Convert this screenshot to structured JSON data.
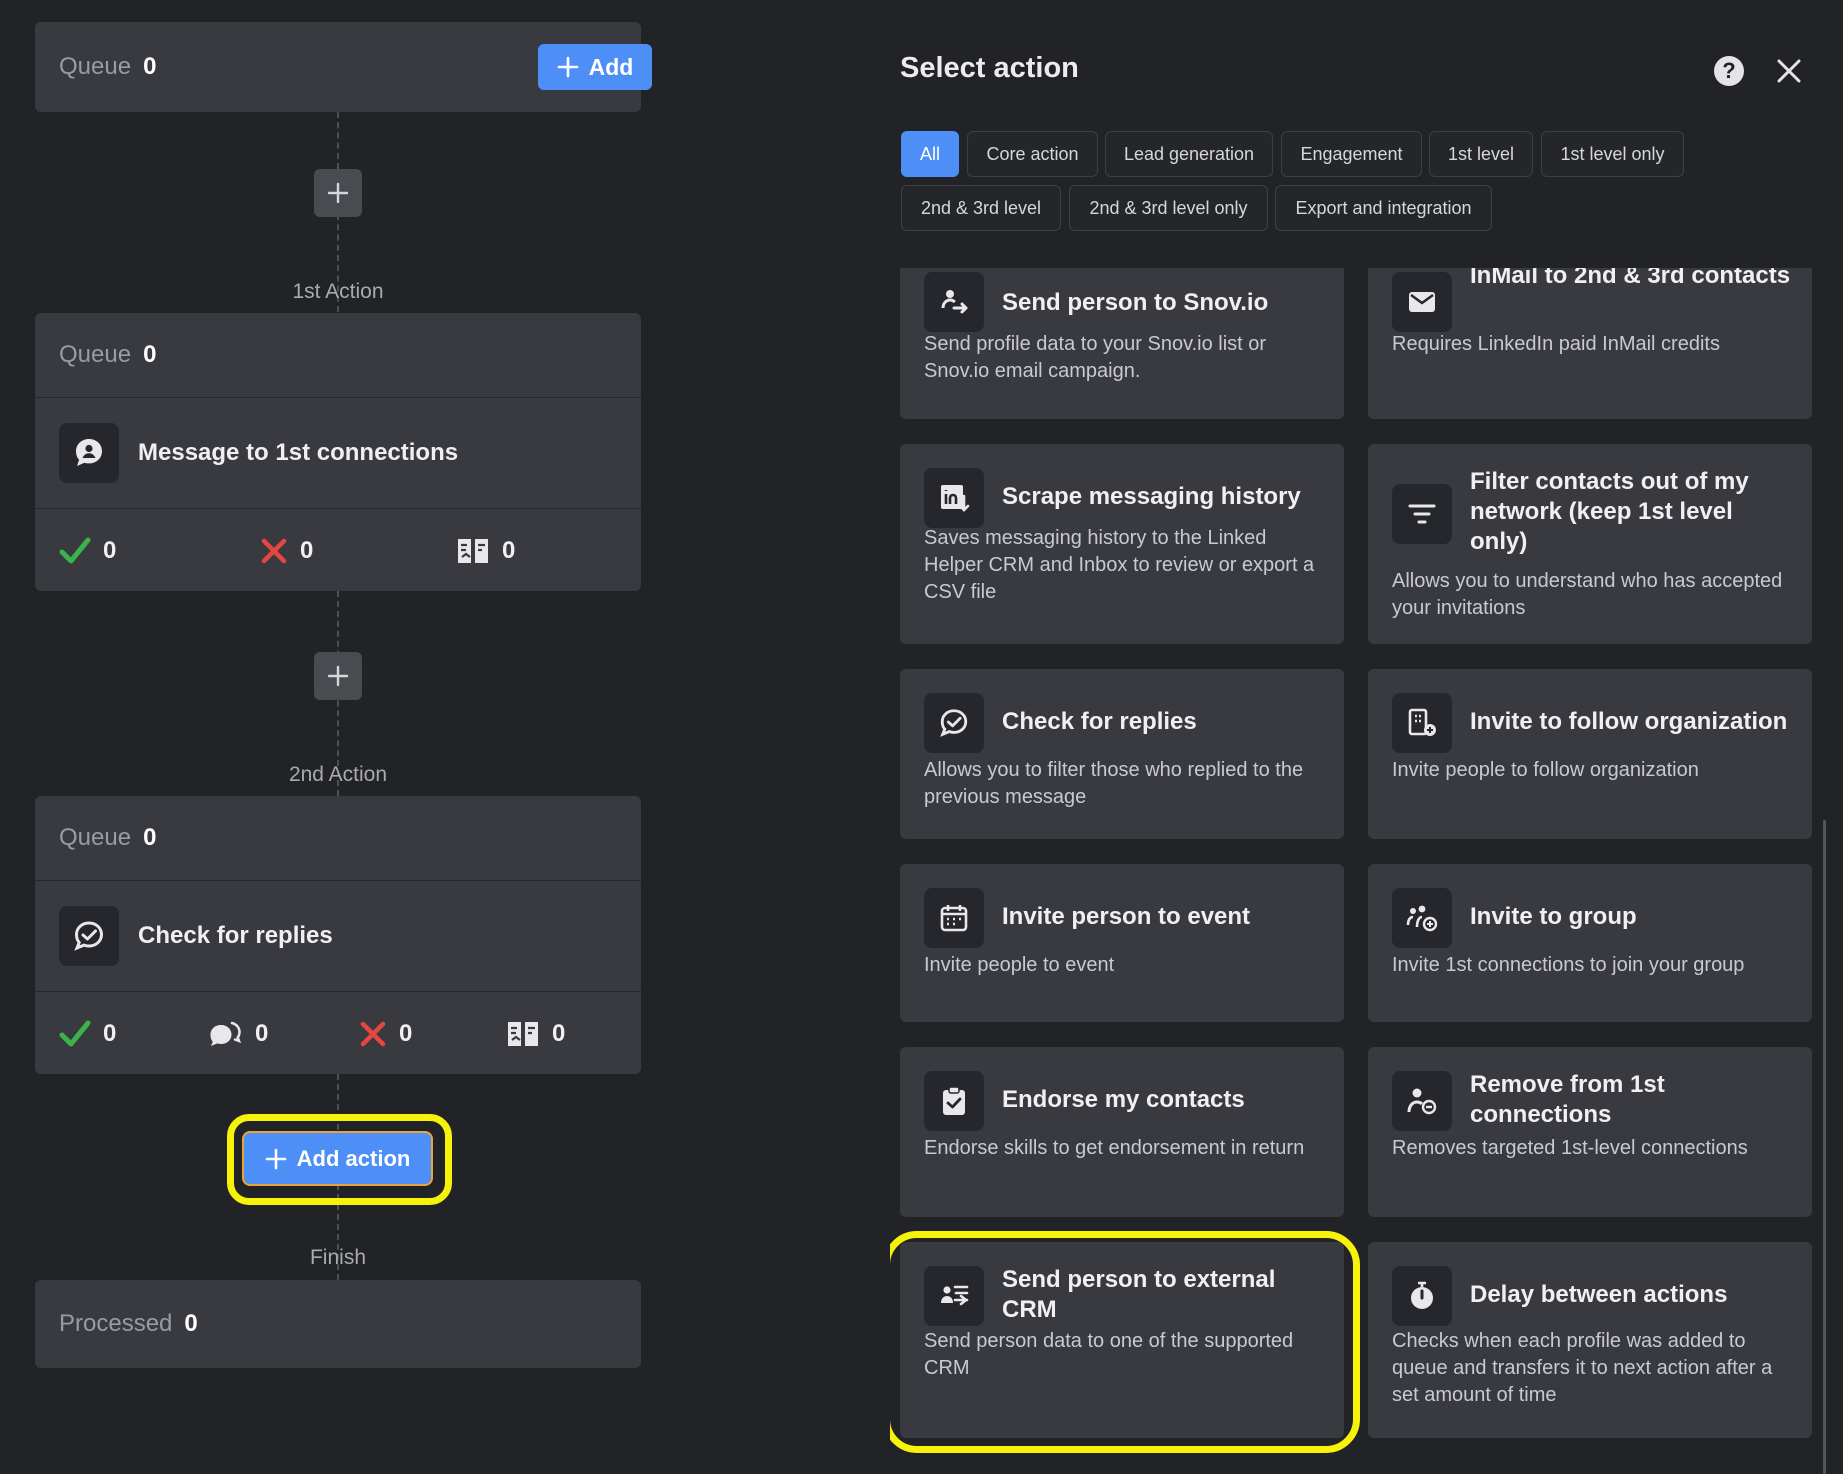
{
  "workflow": {
    "queue_label": "Queue",
    "top": {
      "queue_value": "0",
      "add_label": "Add"
    },
    "step1": {
      "label": "1st Action",
      "queue_value": "0",
      "title": "Message to 1st connections",
      "stats": {
        "success": "0",
        "failed": "0",
        "skipped": "0"
      }
    },
    "step2": {
      "label": "2nd Action",
      "queue_value": "0",
      "title": "Check for replies",
      "stats": {
        "success": "0",
        "replied": "0",
        "failed": "0",
        "skipped": "0"
      }
    },
    "add_action_label": "Add action",
    "finish": {
      "label": "Finish",
      "processed_label": "Processed",
      "processed_value": "0"
    }
  },
  "panel": {
    "title": "Select action",
    "filters": [
      "All",
      "Core action",
      "Lead generation",
      "Engagement",
      "1st level",
      "1st level only",
      "2nd & 3rd level",
      "2nd & 3rd level only",
      "Export and integration"
    ],
    "active_filter": "All",
    "tiles": [
      {
        "title": "Send person to Snov.io",
        "desc": "Send profile data to your Snov.io list or Snov.io email campaign.",
        "icon": "person-transfer-icon"
      },
      {
        "title": "InMail to 2nd & 3rd contacts",
        "desc": "Requires LinkedIn paid InMail credits",
        "icon": "envelope-icon"
      },
      {
        "title": "Scrape messaging history",
        "desc": "Saves messaging history to the Linked Helper CRM and Inbox to review or export a CSV file",
        "icon": "linkedin-download-icon"
      },
      {
        "title": "Filter contacts out of my network (keep 1st level only)",
        "desc": "Allows you to understand who has accepted your invitations",
        "icon": "filter-icon"
      },
      {
        "title": "Check for replies",
        "desc": "Allows you to filter those who replied to the previous message",
        "icon": "chat-check-icon"
      },
      {
        "title": "Invite to follow organization",
        "desc": "Invite people to follow organization",
        "icon": "organization-plus-icon"
      },
      {
        "title": "Invite person to event",
        "desc": "Invite people to event",
        "icon": "calendar-icon"
      },
      {
        "title": "Invite to group",
        "desc": "Invite 1st connections to join your group",
        "icon": "group-plus-icon"
      },
      {
        "title": "Endorse my contacts",
        "desc": "Endorse skills to get endorsement in return",
        "icon": "clipboard-check-icon"
      },
      {
        "title": "Remove from 1st connections",
        "desc": "Removes targeted 1st-level connections",
        "icon": "person-minus-icon"
      },
      {
        "title": "Send person to external CRM",
        "desc": "Send person data to one of the supported CRM",
        "icon": "contact-card-transfer-icon"
      },
      {
        "title": "Delay between actions",
        "desc": "Checks when each profile was added to queue and transfers it to next action after a set amount of time",
        "icon": "stopwatch-icon"
      }
    ]
  },
  "colors": {
    "accent": "#4d8ff7",
    "highlight": "#f6f20a",
    "success": "#3bb34a",
    "danger": "#e5473f",
    "background": "#222327",
    "card": "#393a40"
  }
}
